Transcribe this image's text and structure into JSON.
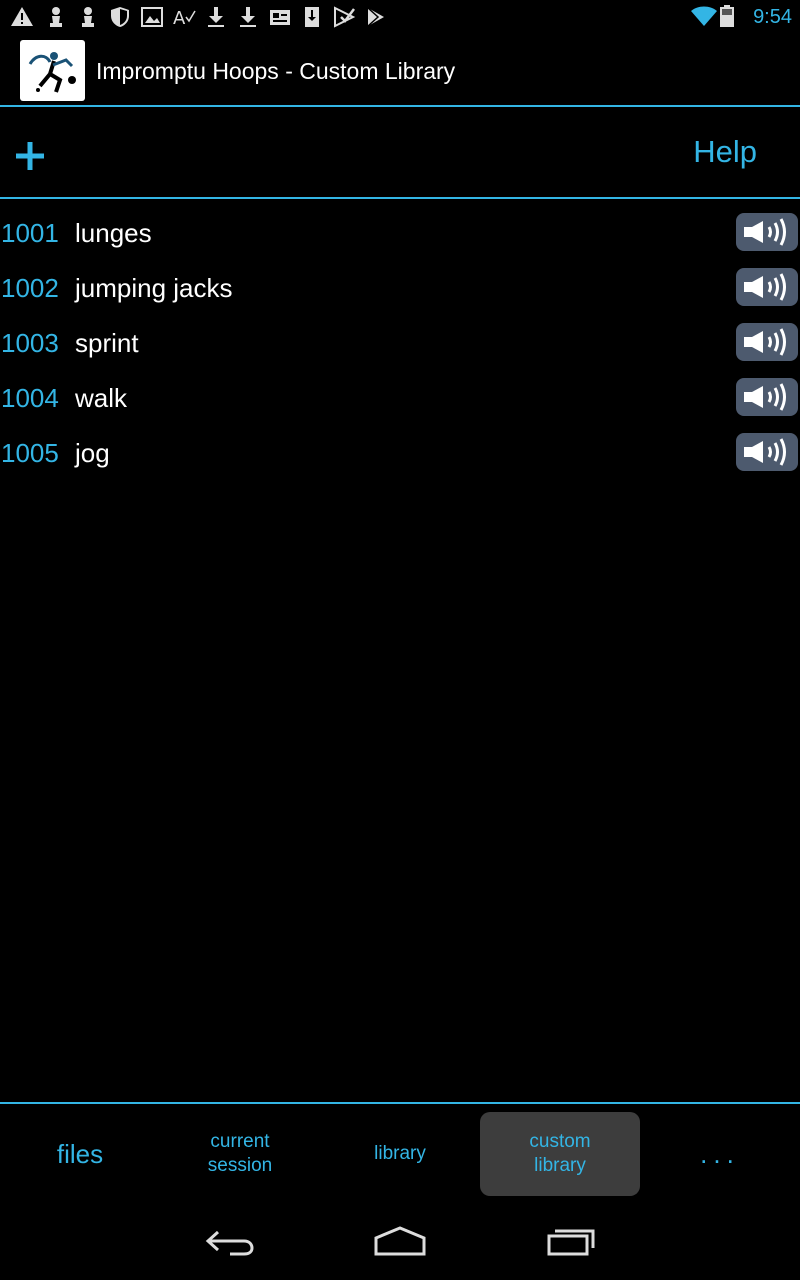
{
  "status_bar": {
    "time": "9:54",
    "left_icons": [
      "warning-icon",
      "chess-pawn-icon",
      "chess-pawn-icon",
      "shield-icon",
      "image-icon",
      "spell-check-icon",
      "download-icon",
      "download-icon",
      "card-icon",
      "sim-download-icon",
      "play-check-icon",
      "play-store-icon"
    ]
  },
  "action_bar": {
    "title": "Impromptu Hoops - Custom Library"
  },
  "toolbar": {
    "add_label": "+",
    "help_label": "Help"
  },
  "list": {
    "items": [
      {
        "id": "1001",
        "name": "lunges"
      },
      {
        "id": "1002",
        "name": "jumping jacks"
      },
      {
        "id": "1003",
        "name": "sprint"
      },
      {
        "id": "1004",
        "name": "walk"
      },
      {
        "id": "1005",
        "name": "jog"
      }
    ]
  },
  "tabs": [
    {
      "label": "files",
      "active": false
    },
    {
      "label": "current\nsession",
      "active": false
    },
    {
      "label": "library",
      "active": false
    },
    {
      "label": "custom\nlibrary",
      "active": true
    },
    {
      "label": "...",
      "active": false
    }
  ],
  "colors": {
    "accent": "#33b5e5",
    "background": "#000000",
    "sound_button": "#4d5a6e",
    "active_tab": "#3d3d3d"
  }
}
